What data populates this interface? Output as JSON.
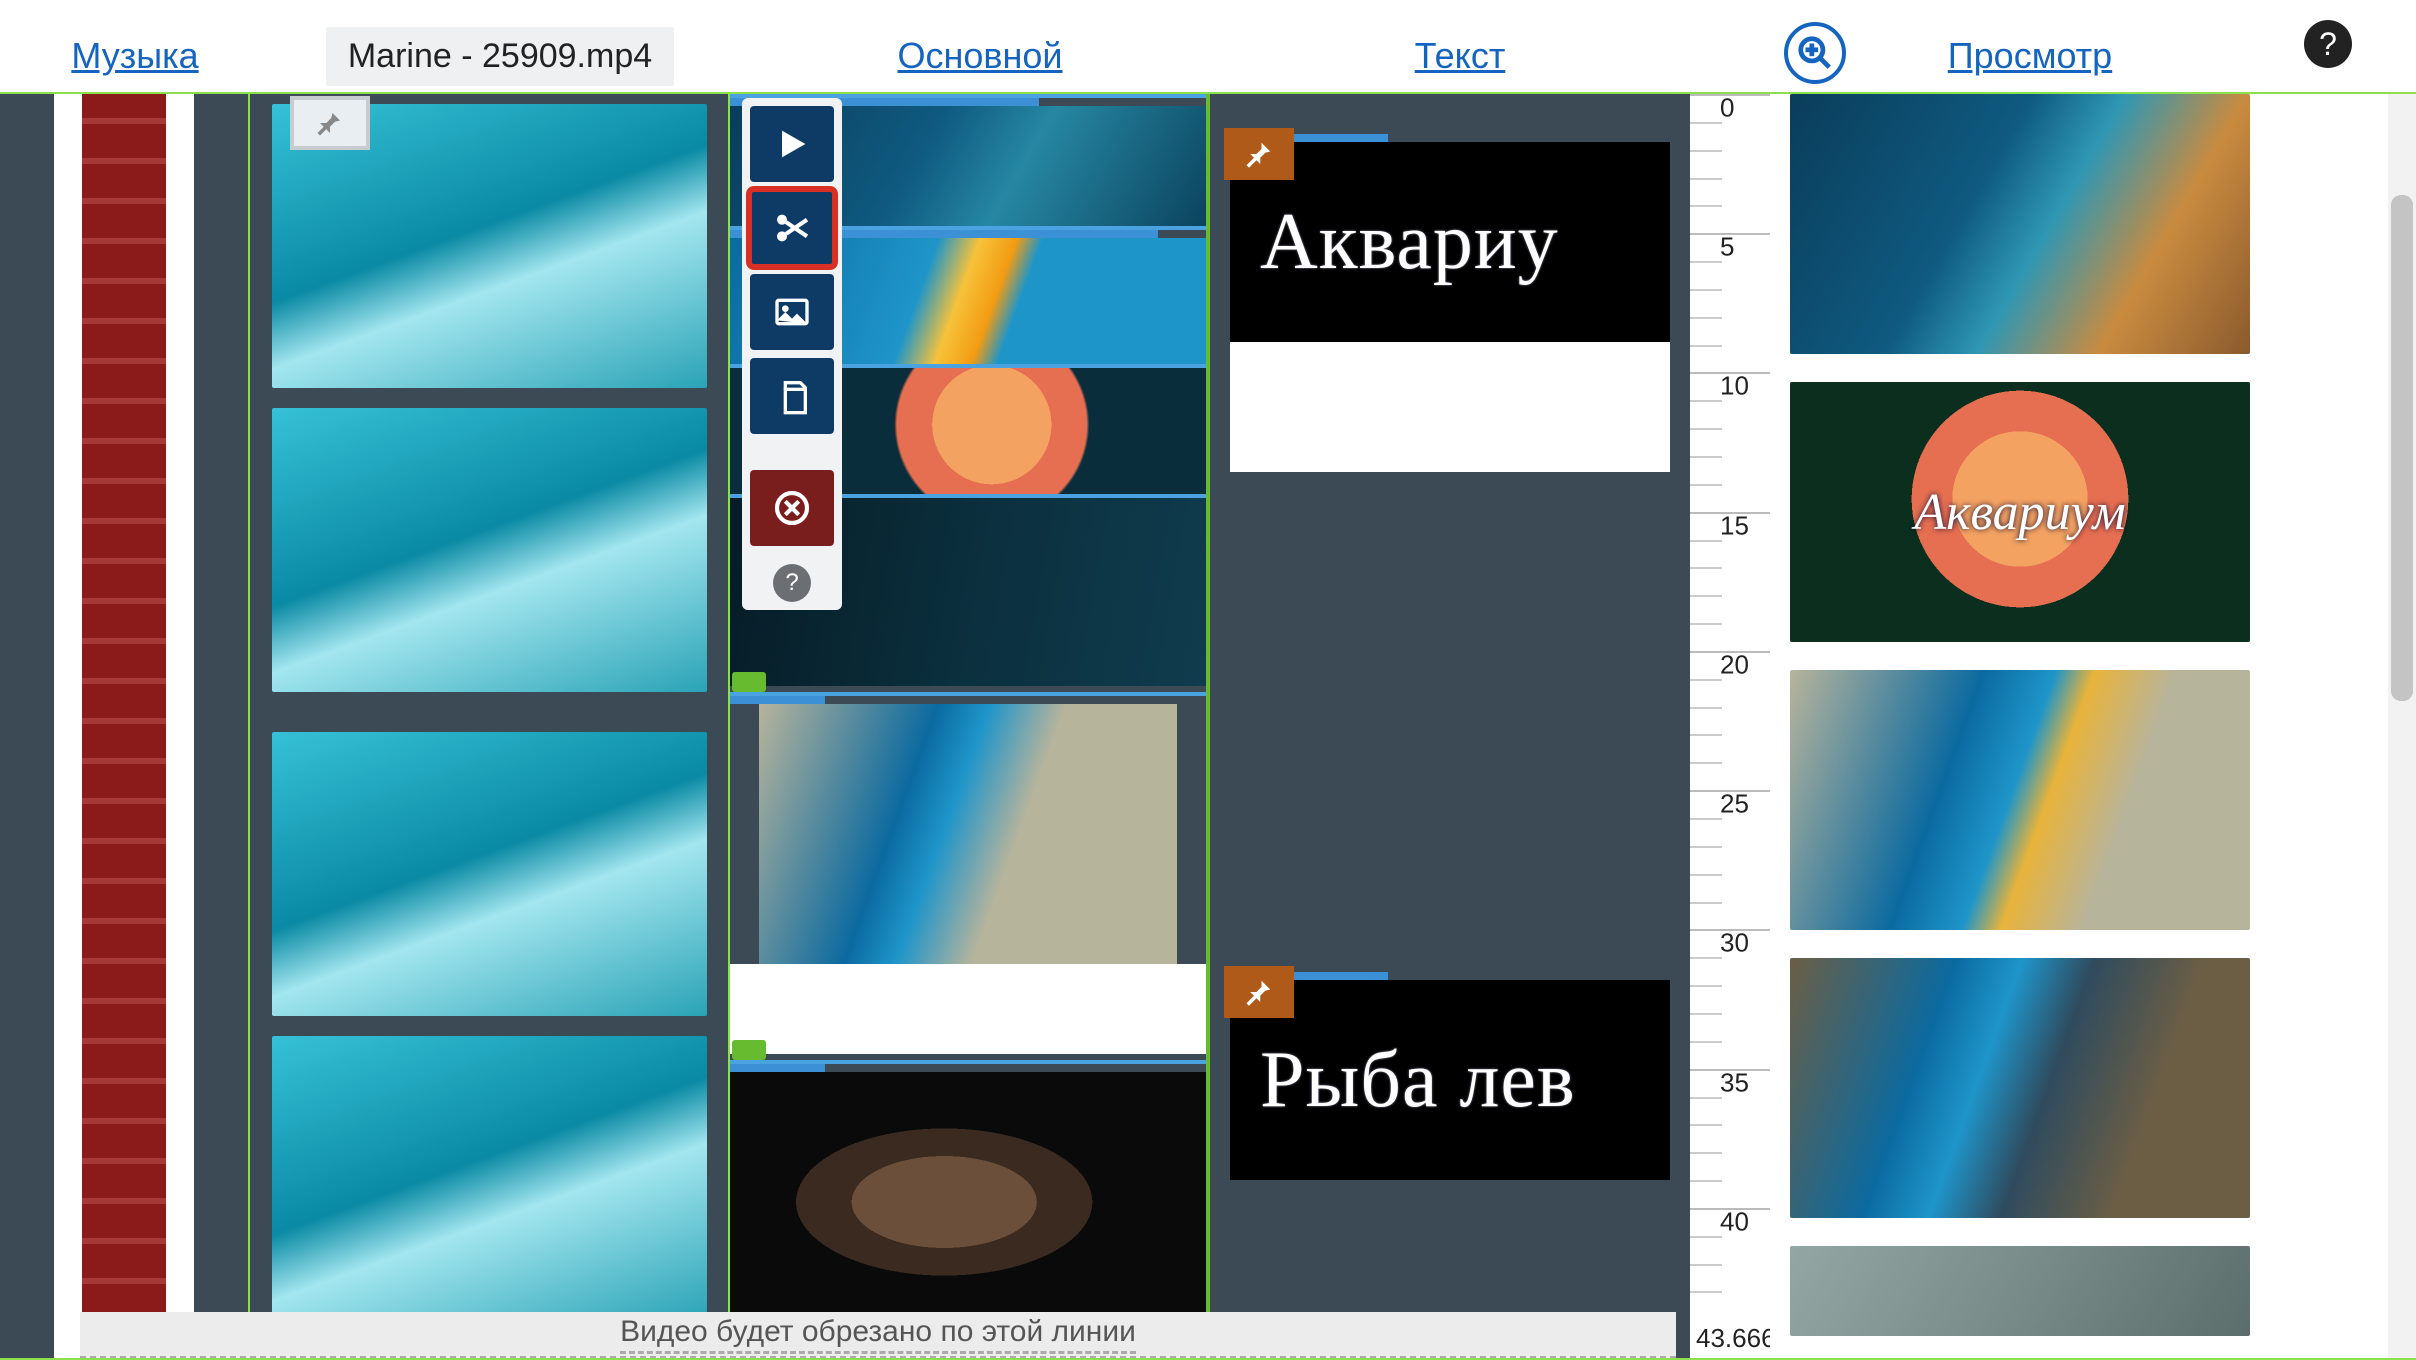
{
  "header": {
    "music": "Музыка",
    "filename": "Marine - 25909.mp4",
    "main": "Основной",
    "text": "Текст",
    "preview": "Просмотр"
  },
  "toolbar": {
    "play": "play",
    "cut": "cut",
    "image": "image",
    "copy": "copy",
    "delete": "delete",
    "help": "?"
  },
  "text_clips": [
    {
      "text": "Аквариу"
    },
    {
      "text": "Рыба лев"
    }
  ],
  "preview_overlay": "Аквариум",
  "ruler": {
    "ticks": [
      0,
      5,
      10,
      15,
      20,
      25,
      30,
      35,
      40
    ],
    "end": "43.666"
  },
  "cut_message": "Видео будет обрезано по этой линии",
  "icons": {
    "zoom": "⦿",
    "help": "?",
    "pin": "📌"
  }
}
